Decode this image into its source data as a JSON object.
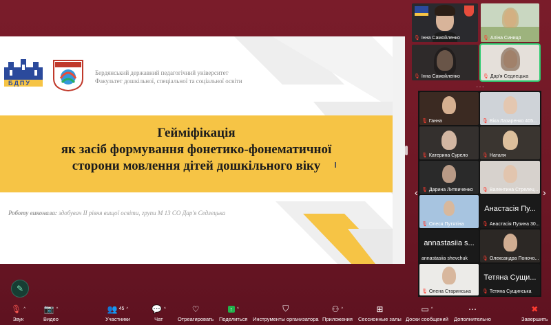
{
  "slide": {
    "university_line1": "Бердянський державний педагогічний університет",
    "university_line2": "Факультет дошкільної, спеціальної та соціальної освіти",
    "logo1_text": "БДПУ",
    "title_line1": "Гейміфікація",
    "title_line2": "як засіб формування фонетико-фонематичної",
    "title_line3": "сторони мовлення дітей дошкільного віку",
    "author_label": "Роботу виконала:",
    "author_text": " здобувач ІІ рівня вищої освіти, групи М 13 СО Дар'я Седлецька"
  },
  "top_videos": [
    {
      "name": "Інна Самойленко",
      "muted": false
    },
    {
      "name": "Аліна Синиця",
      "muted": true
    },
    {
      "name": "Інна Самойленко",
      "muted": true
    },
    {
      "name": "Дар'я Седлецька",
      "muted": true
    }
  ],
  "gallery": {
    "dots": "···",
    "tiles": [
      {
        "name": "Ганна",
        "muted": true,
        "video": true
      },
      {
        "name": "Віка Лазаренко 405...",
        "muted": true,
        "video": true
      },
      {
        "name": "Катерина Сурело",
        "muted": true,
        "video": true
      },
      {
        "name": "Наталя",
        "muted": true,
        "video": true
      },
      {
        "name": "Дарина Литвиченко",
        "muted": true,
        "video": true
      },
      {
        "name": "Валентина Стрелец...",
        "muted": true,
        "video": true
      },
      {
        "name": "Олеся Путятіна",
        "muted": true,
        "video": true
      },
      {
        "name": "Анастасія Пузина 30...",
        "muted": true,
        "video": false,
        "big": "Анастасія Пу..."
      },
      {
        "name": "annastasiia shevchuk",
        "muted": false,
        "video": false,
        "big": "annastasiia s..."
      },
      {
        "name": "Олександра Поночо...",
        "muted": true,
        "video": true
      },
      {
        "name": "Олена Старинська",
        "muted": true,
        "video": true
      },
      {
        "name": "Тетяна Сущинська",
        "muted": true,
        "video": false,
        "big": "Тетяна Сущи..."
      }
    ]
  },
  "toolbar": {
    "audio": "Звук",
    "video": "Видео",
    "participants": "Участники",
    "participants_count": "45",
    "chat": "Чат",
    "react": "Отреагировать",
    "share": "Поделиться",
    "host_tools": "Инструменты организатора",
    "apps": "Приложения",
    "breakout": "Сессионные залы",
    "whiteboard": "Доски сообщений",
    "more": "Дополнительно",
    "end": "Завершить"
  },
  "colors": {
    "background": "#6f1826",
    "banner": "#f6c445",
    "active_speaker": "#2ecc71",
    "muted": "#ff3b30"
  }
}
